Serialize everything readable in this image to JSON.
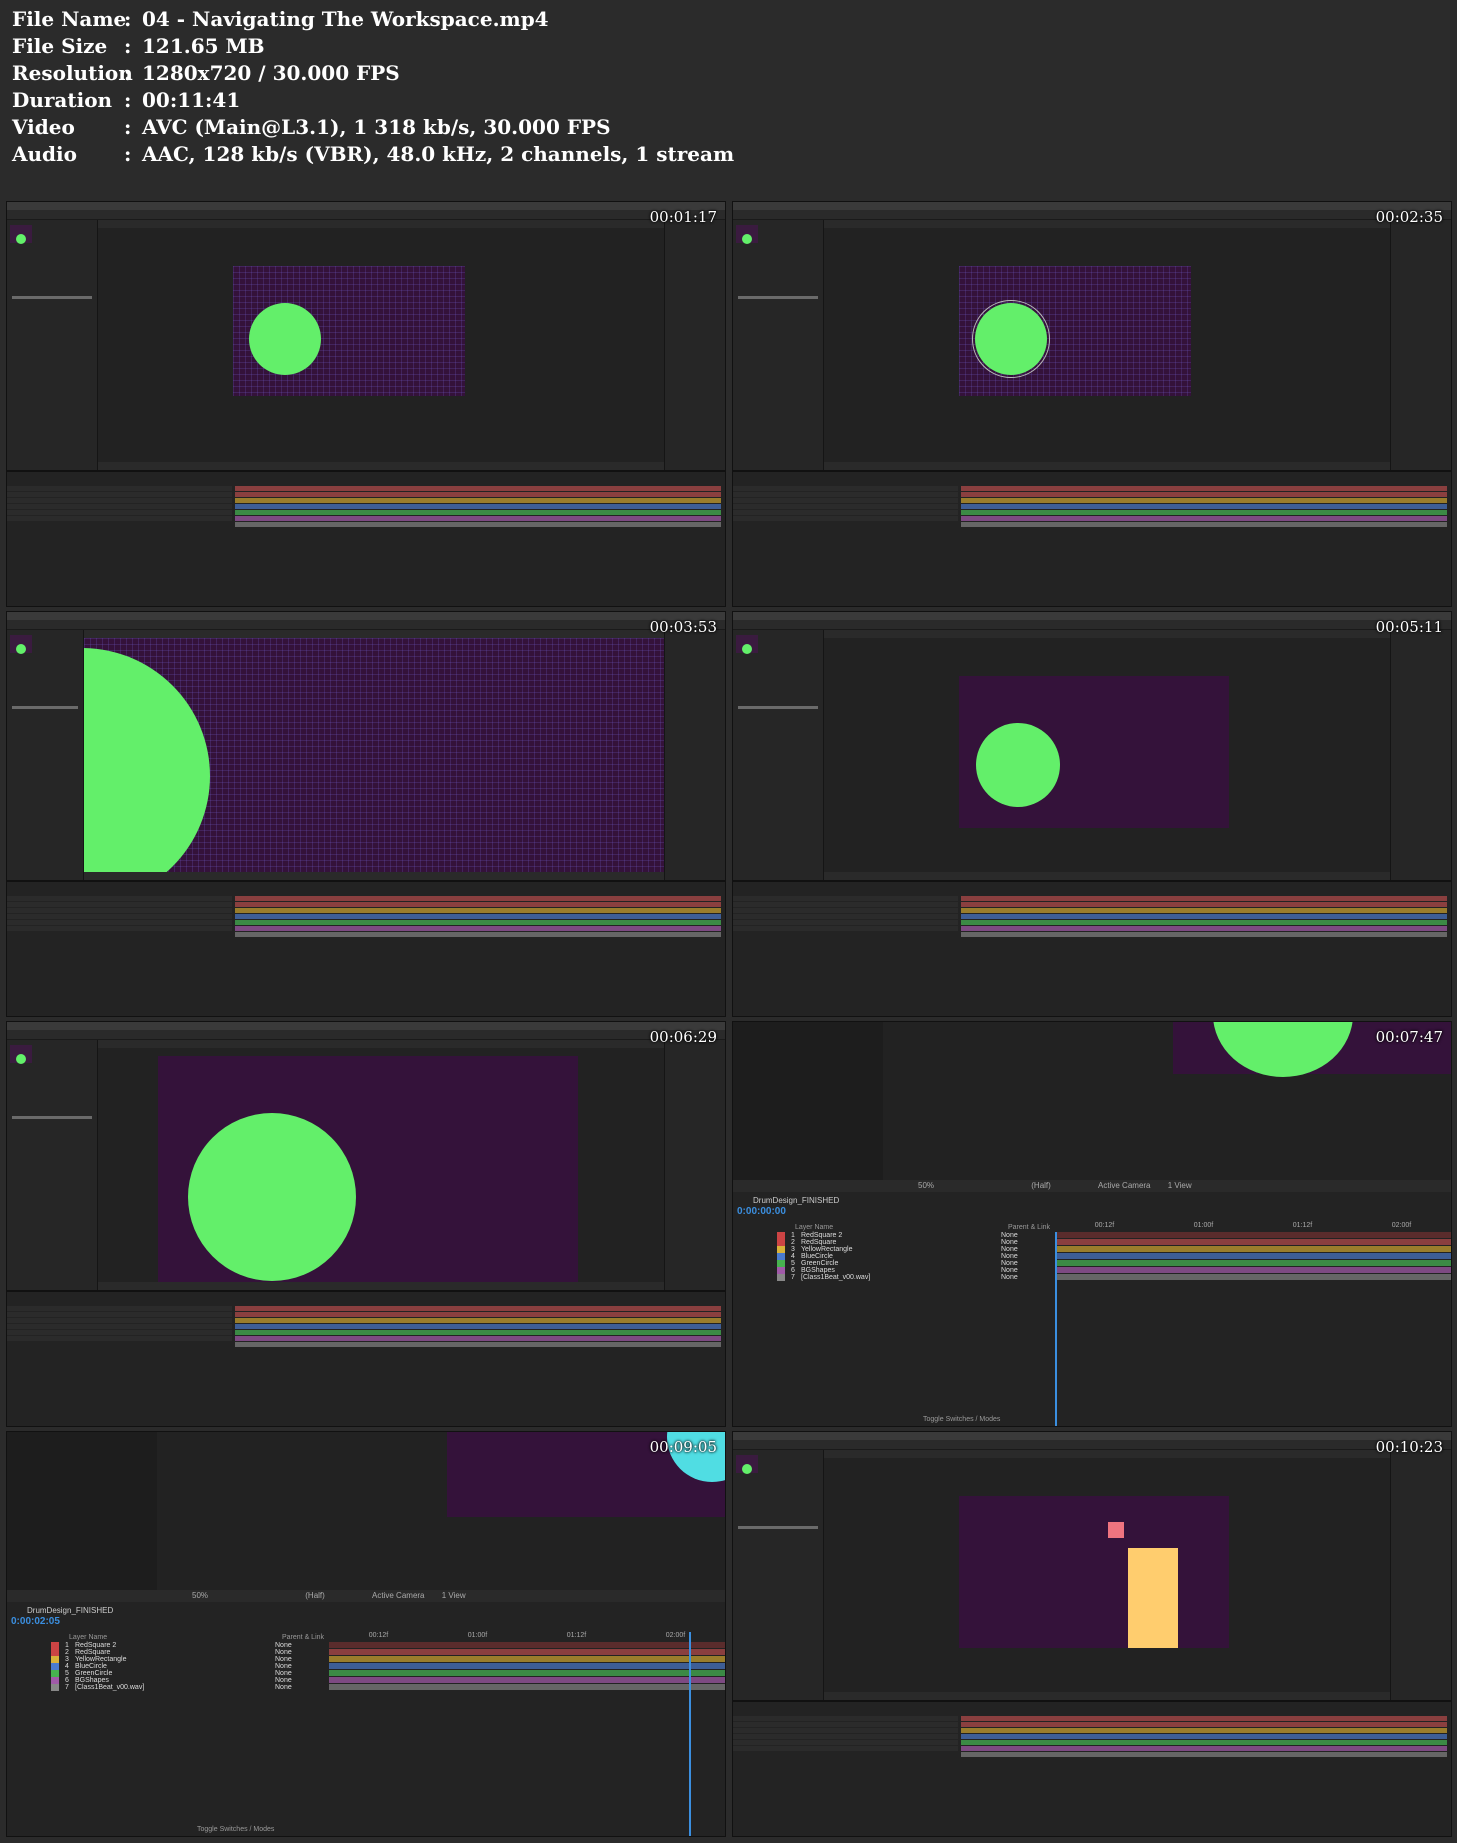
{
  "info": [
    {
      "label": "File Name",
      "value": "04 - Navigating The Workspace.mp4"
    },
    {
      "label": "File Size",
      "value": "121.65 MB"
    },
    {
      "label": "Resolution",
      "value": "1280x720 / 30.000 FPS"
    },
    {
      "label": "Duration",
      "value": "00:11:41"
    },
    {
      "label": "Video",
      "value": "AVC (Main@L3.1), 1 318 kb/s, 30.000 FPS"
    },
    {
      "label": "Audio",
      "value": "AAC, 128 kb/s (VBR), 48.0 kHz, 2 channels, 1 stream"
    }
  ],
  "separator": ":",
  "thumbnails": [
    {
      "timestamp": "00:01:17"
    },
    {
      "timestamp": "00:02:35"
    },
    {
      "timestamp": "00:03:53"
    },
    {
      "timestamp": "00:05:11"
    },
    {
      "timestamp": "00:06:29"
    },
    {
      "timestamp": "00:07:47"
    },
    {
      "timestamp": "00:09:05"
    },
    {
      "timestamp": "00:10:23"
    }
  ],
  "zoomed_panel": {
    "comp_name": "DrumDesign_FINISHED",
    "time_f6": "0:00:00:00",
    "time_f7": "0:00:02:05",
    "zoom": "50%",
    "resolution": "(Half)",
    "camera": "Active Camera",
    "views": "1 View",
    "column_layer_name": "Layer Name",
    "column_parent": "Parent & Link",
    "toggle": "Toggle Switches / Modes",
    "layers": [
      {
        "num": "1",
        "name": "RedSquare 2",
        "parent": "None",
        "color": "#c44"
      },
      {
        "num": "2",
        "name": "RedSquare",
        "parent": "None",
        "color": "#c44"
      },
      {
        "num": "3",
        "name": "YellowRectangle",
        "parent": "None",
        "color": "#d9b23a"
      },
      {
        "num": "4",
        "name": "BlueCircle",
        "parent": "None",
        "color": "#4a7bd0"
      },
      {
        "num": "5",
        "name": "GreenCircle",
        "parent": "None",
        "color": "#47b24f"
      },
      {
        "num": "6",
        "name": "BGShapes",
        "parent": "None",
        "color": "#a05aa8"
      },
      {
        "num": "7",
        "name": "[Class1Beat_v00.wav]",
        "parent": "None",
        "color": "#888"
      }
    ],
    "ruler": [
      "00:12f",
      "01:00f",
      "01:12f",
      "02:00f"
    ]
  },
  "colors": {
    "comp_bg": "#34123a",
    "green_circle": "#63ef6a",
    "cyan_circle": "#50dde3",
    "red_square": "#f07480",
    "yellow_rect": "#ffcd6e"
  }
}
